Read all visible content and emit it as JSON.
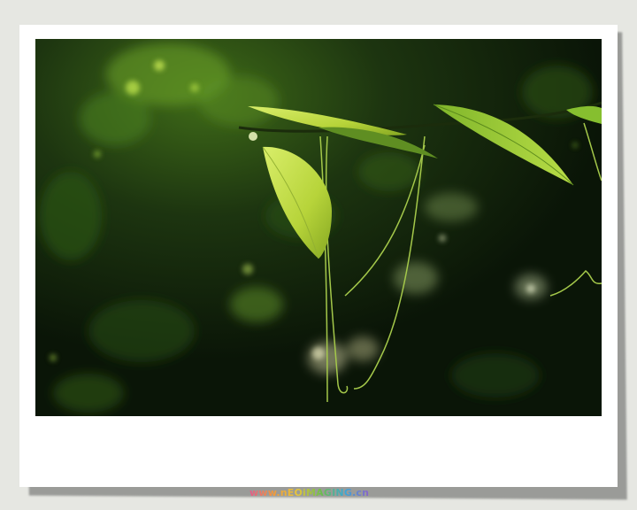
{
  "frame": {
    "background_color": "#e6e7e2",
    "card_color": "#ffffff",
    "shadow_color": "#9a9b98"
  },
  "photo": {
    "subject": "backlit green leaves on a thin vine with tendrils against a dark bokeh forest background",
    "palette": [
      "#0c1a08",
      "#1f3a12",
      "#4d7a1e",
      "#b9d83a",
      "#e4f27a"
    ]
  },
  "watermark": {
    "text": "www.nEOiMAGING.cn",
    "colors": [
      "#e25a8c",
      "#f29a3a",
      "#e7c63a",
      "#6cbf4a",
      "#3aa7d8",
      "#8a62c9"
    ]
  }
}
